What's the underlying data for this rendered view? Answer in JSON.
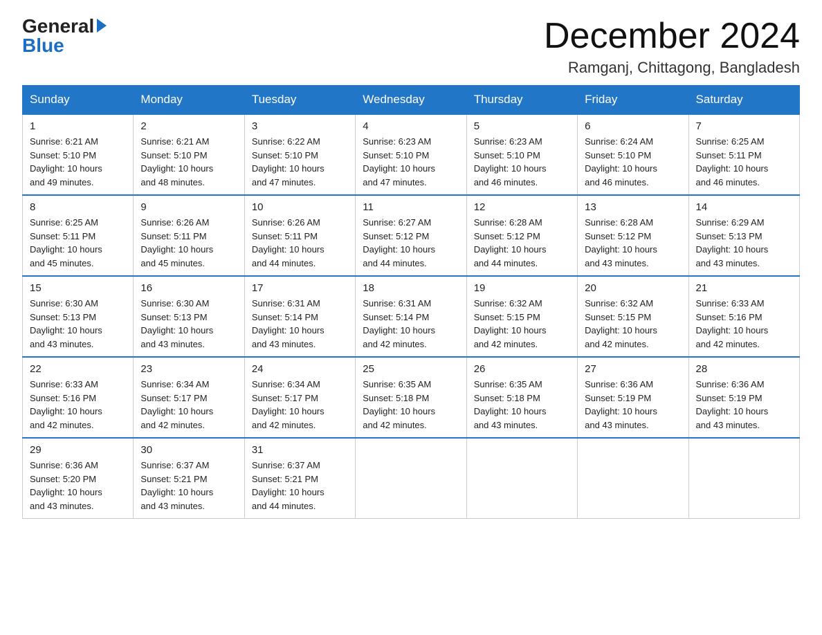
{
  "logo": {
    "general": "General",
    "blue": "Blue"
  },
  "header": {
    "month_title": "December 2024",
    "location": "Ramganj, Chittagong, Bangladesh"
  },
  "days_of_week": [
    "Sunday",
    "Monday",
    "Tuesday",
    "Wednesday",
    "Thursday",
    "Friday",
    "Saturday"
  ],
  "weeks": [
    [
      {
        "day": "1",
        "sunrise": "6:21 AM",
        "sunset": "5:10 PM",
        "daylight": "10 hours and 49 minutes."
      },
      {
        "day": "2",
        "sunrise": "6:21 AM",
        "sunset": "5:10 PM",
        "daylight": "10 hours and 48 minutes."
      },
      {
        "day": "3",
        "sunrise": "6:22 AM",
        "sunset": "5:10 PM",
        "daylight": "10 hours and 47 minutes."
      },
      {
        "day": "4",
        "sunrise": "6:23 AM",
        "sunset": "5:10 PM",
        "daylight": "10 hours and 47 minutes."
      },
      {
        "day": "5",
        "sunrise": "6:23 AM",
        "sunset": "5:10 PM",
        "daylight": "10 hours and 46 minutes."
      },
      {
        "day": "6",
        "sunrise": "6:24 AM",
        "sunset": "5:10 PM",
        "daylight": "10 hours and 46 minutes."
      },
      {
        "day": "7",
        "sunrise": "6:25 AM",
        "sunset": "5:11 PM",
        "daylight": "10 hours and 46 minutes."
      }
    ],
    [
      {
        "day": "8",
        "sunrise": "6:25 AM",
        "sunset": "5:11 PM",
        "daylight": "10 hours and 45 minutes."
      },
      {
        "day": "9",
        "sunrise": "6:26 AM",
        "sunset": "5:11 PM",
        "daylight": "10 hours and 45 minutes."
      },
      {
        "day": "10",
        "sunrise": "6:26 AM",
        "sunset": "5:11 PM",
        "daylight": "10 hours and 44 minutes."
      },
      {
        "day": "11",
        "sunrise": "6:27 AM",
        "sunset": "5:12 PM",
        "daylight": "10 hours and 44 minutes."
      },
      {
        "day": "12",
        "sunrise": "6:28 AM",
        "sunset": "5:12 PM",
        "daylight": "10 hours and 44 minutes."
      },
      {
        "day": "13",
        "sunrise": "6:28 AM",
        "sunset": "5:12 PM",
        "daylight": "10 hours and 43 minutes."
      },
      {
        "day": "14",
        "sunrise": "6:29 AM",
        "sunset": "5:13 PM",
        "daylight": "10 hours and 43 minutes."
      }
    ],
    [
      {
        "day": "15",
        "sunrise": "6:30 AM",
        "sunset": "5:13 PM",
        "daylight": "10 hours and 43 minutes."
      },
      {
        "day": "16",
        "sunrise": "6:30 AM",
        "sunset": "5:13 PM",
        "daylight": "10 hours and 43 minutes."
      },
      {
        "day": "17",
        "sunrise": "6:31 AM",
        "sunset": "5:14 PM",
        "daylight": "10 hours and 43 minutes."
      },
      {
        "day": "18",
        "sunrise": "6:31 AM",
        "sunset": "5:14 PM",
        "daylight": "10 hours and 42 minutes."
      },
      {
        "day": "19",
        "sunrise": "6:32 AM",
        "sunset": "5:15 PM",
        "daylight": "10 hours and 42 minutes."
      },
      {
        "day": "20",
        "sunrise": "6:32 AM",
        "sunset": "5:15 PM",
        "daylight": "10 hours and 42 minutes."
      },
      {
        "day": "21",
        "sunrise": "6:33 AM",
        "sunset": "5:16 PM",
        "daylight": "10 hours and 42 minutes."
      }
    ],
    [
      {
        "day": "22",
        "sunrise": "6:33 AM",
        "sunset": "5:16 PM",
        "daylight": "10 hours and 42 minutes."
      },
      {
        "day": "23",
        "sunrise": "6:34 AM",
        "sunset": "5:17 PM",
        "daylight": "10 hours and 42 minutes."
      },
      {
        "day": "24",
        "sunrise": "6:34 AM",
        "sunset": "5:17 PM",
        "daylight": "10 hours and 42 minutes."
      },
      {
        "day": "25",
        "sunrise": "6:35 AM",
        "sunset": "5:18 PM",
        "daylight": "10 hours and 42 minutes."
      },
      {
        "day": "26",
        "sunrise": "6:35 AM",
        "sunset": "5:18 PM",
        "daylight": "10 hours and 43 minutes."
      },
      {
        "day": "27",
        "sunrise": "6:36 AM",
        "sunset": "5:19 PM",
        "daylight": "10 hours and 43 minutes."
      },
      {
        "day": "28",
        "sunrise": "6:36 AM",
        "sunset": "5:19 PM",
        "daylight": "10 hours and 43 minutes."
      }
    ],
    [
      {
        "day": "29",
        "sunrise": "6:36 AM",
        "sunset": "5:20 PM",
        "daylight": "10 hours and 43 minutes."
      },
      {
        "day": "30",
        "sunrise": "6:37 AM",
        "sunset": "5:21 PM",
        "daylight": "10 hours and 43 minutes."
      },
      {
        "day": "31",
        "sunrise": "6:37 AM",
        "sunset": "5:21 PM",
        "daylight": "10 hours and 44 minutes."
      },
      null,
      null,
      null,
      null
    ]
  ],
  "labels": {
    "sunrise": "Sunrise:",
    "sunset": "Sunset:",
    "daylight": "Daylight:"
  }
}
